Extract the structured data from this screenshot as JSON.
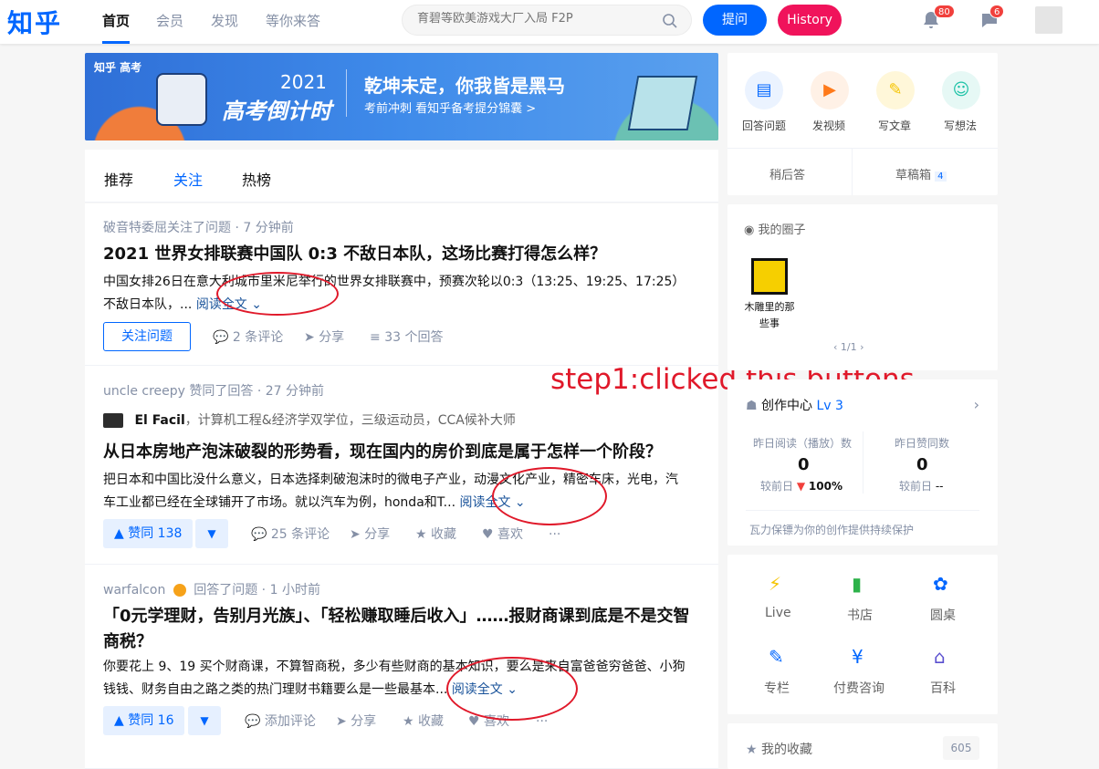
{
  "header": {
    "logo": "知乎",
    "nav": [
      "首页",
      "会员",
      "发现",
      "等你来答"
    ],
    "search_placeholder": "育碧等欧美游戏大厂入局 F2P",
    "ask_label": "提问",
    "history_label": "History",
    "notifications_count": "80",
    "messages_count": "6"
  },
  "banner": {
    "brand": "知乎 高考",
    "year": "2021",
    "title": "高考倒计时",
    "headline": "乾坤未定，你我皆是黑马",
    "sub": "考前冲刺 看知乎备考提分锦囊 >"
  },
  "tabs": [
    "推荐",
    "关注",
    "热榜"
  ],
  "feed": [
    {
      "meta": "破音特委屈关注了问题 · 7 分钟前",
      "title": "2021 世界女排联赛中国队 0:3 不敌日本队，这场比赛打得怎么样？",
      "excerpt": "中国女排26日在意大利城市里米尼举行的世界女排联赛中，预赛次轮以0:3（13:25、19:25、17:25）不敌日本队，...",
      "read_more": "阅读全文",
      "follow_label": "关注问题",
      "comments": "2 条评论",
      "share": "分享",
      "answers": "33 个回答"
    },
    {
      "meta": "uncle creepy 赞同了回答 · 27 分钟前",
      "author": "El Facil",
      "author_bio": "，计算机工程&经济学双学位，三级运动员，CCA候补大师",
      "title": "从日本房地产泡沫破裂的形势看，现在国内的房价到底是属于怎样一个阶段？",
      "excerpt": "把日本和中国比没什么意义，日本选择刺破泡沫时的微电子产业，动漫文化产业，精密车床，光电，汽车工业都已经在全球铺开了市场。就以汽车为例，honda和T...",
      "read_more": "阅读全文",
      "vote": "赞同 138",
      "comments": "25 条评论",
      "share": "分享",
      "collect": "收藏",
      "like": "喜欢",
      "more": "···"
    },
    {
      "meta_user": "warfalcon",
      "meta": "回答了问题 · 1 小时前",
      "title": "「0元学理财，告别月光族」、「轻松赚取睡后收入」……报财商课到底是不是交智商税？",
      "excerpt": "你要花上 9、19 买个财商课，不算智商税，多少有些财商的基本知识，要么是来自富爸爸穷爸爸、小狗钱钱、财务自由之路之类的热门理财书籍要么是一些最基本...",
      "read_more": "阅读全文",
      "vote": "赞同 16",
      "comments": "添加评论",
      "share": "分享",
      "collect": "收藏",
      "like": "喜欢",
      "more": "···"
    }
  ],
  "annotation": "step1:clicked this buttons",
  "sidebar": {
    "create": [
      "回答问题",
      "发视频",
      "写文章",
      "写想法"
    ],
    "later": "稍后答",
    "drafts": "草稿箱",
    "drafts_count": "4",
    "circles_title": "我的圈子",
    "circle_name": "木雕里的那些事",
    "circle_page": "1/1",
    "creator_title": "创作中心",
    "creator_level": "Lv 3",
    "stat1_label": "昨日阅读（播放）数",
    "stat1_value": "0",
    "stat1_cmp": "较前日",
    "stat1_pct": "100%",
    "stat2_label": "昨日赞同数",
    "stat2_value": "0",
    "stat2_cmp": "较前日",
    "stat2_pct": "--",
    "protect": "瓦力保镖为你的创作提供持续保护",
    "services": [
      "Live",
      "书店",
      "圆桌",
      "专栏",
      "付费咨询",
      "百科"
    ],
    "favorites": "我的收藏",
    "favorites_count": "605"
  }
}
